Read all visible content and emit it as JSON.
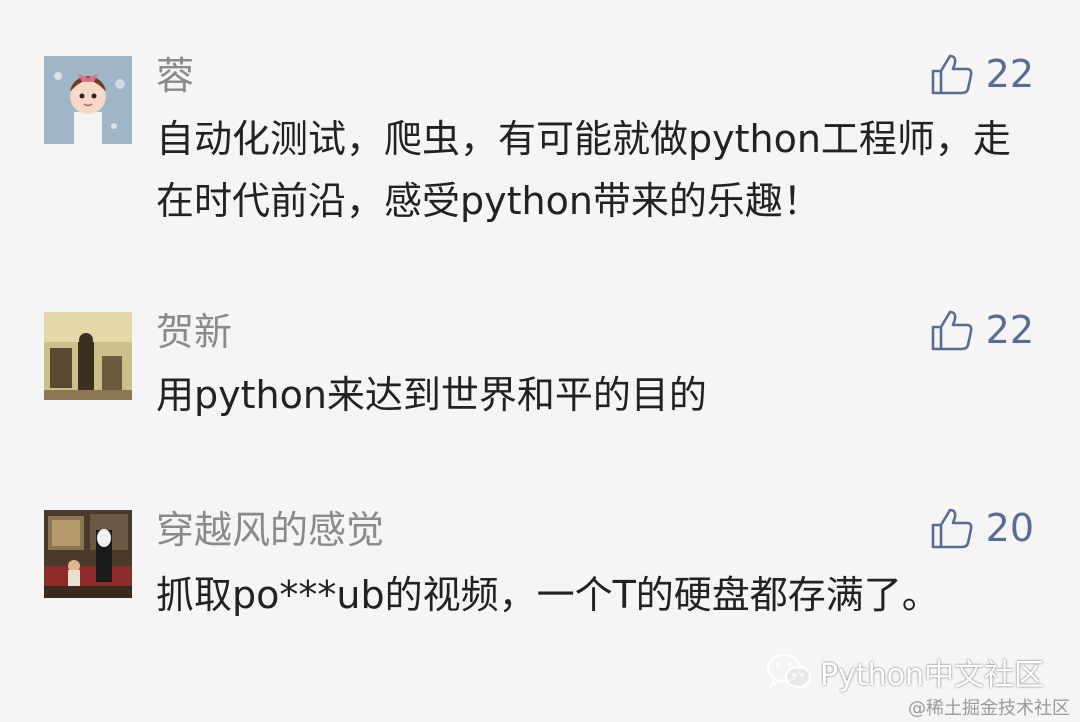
{
  "comments": [
    {
      "username": "蓉",
      "text": "自动化测试，爬虫，有可能就做python工程师，走在时代前沿，感受python带来的乐趣！",
      "likes": "22",
      "avatar": "avatar-girl"
    },
    {
      "username": "贺新",
      "text": "用python来达到世界和平的目的",
      "likes": "22",
      "avatar": "avatar-photo-sepia"
    },
    {
      "username": "穿越风的感觉",
      "text": "抓取po***ub的视频，一个T的硬盘都存满了。",
      "likes": "20",
      "avatar": "avatar-train-scene"
    }
  ],
  "icons": {
    "like": "thumbs-up-icon",
    "watermark": "wechat-icon"
  },
  "colors": {
    "like": "#5b6c94",
    "username": "#8a8a8a",
    "text": "#222222",
    "background": "#f5f5f5"
  },
  "watermark": {
    "label": "Python中文社区"
  },
  "source": {
    "label": "@稀土掘金技术社区"
  }
}
